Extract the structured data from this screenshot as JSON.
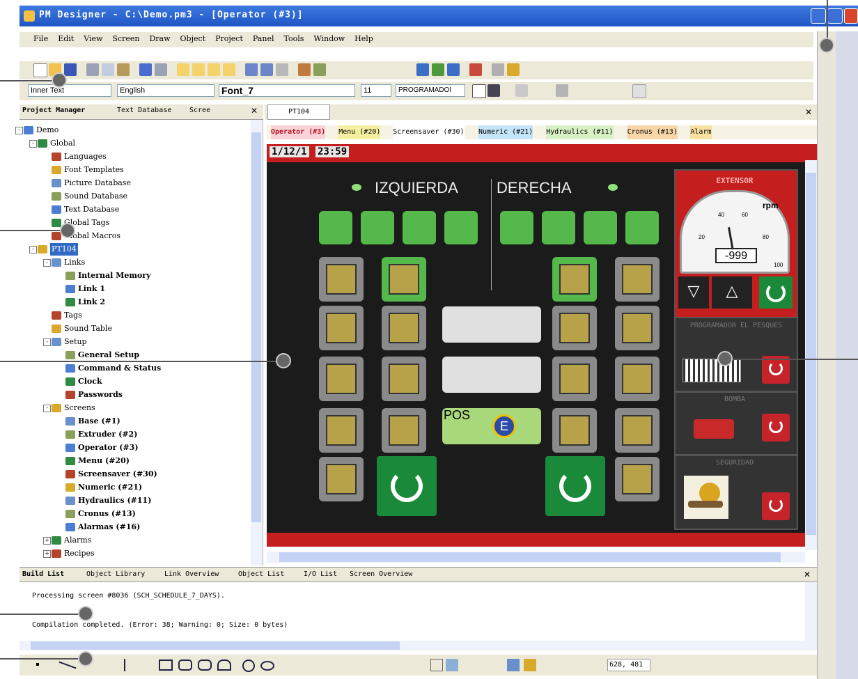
{
  "window": {
    "title": "PM Designer - C:\\Demo.pm3 - [Operator (#3)]",
    "menu": [
      "File",
      "Edit",
      "View",
      "Screen",
      "Draw",
      "Object",
      "Project",
      "Panel",
      "Tools",
      "Window",
      "Help"
    ]
  },
  "format_bar": {
    "text_type": "Inner Text",
    "language": "English",
    "font": "Font_7",
    "size": "11",
    "text_value": "PROGRAMADOI"
  },
  "left_panel": {
    "tabs": [
      "Project Manager",
      "Text Database",
      "Scree"
    ],
    "tree": [
      {
        "label": "Demo",
        "indent": 0,
        "exp": "-"
      },
      {
        "label": "Global",
        "indent": 1,
        "exp": "-"
      },
      {
        "label": "Languages",
        "indent": 2
      },
      {
        "label": "Font Templates",
        "indent": 2
      },
      {
        "label": "Picture Database",
        "indent": 2
      },
      {
        "label": "Sound Database",
        "indent": 2
      },
      {
        "label": "Text Database",
        "indent": 2
      },
      {
        "label": "Global Tags",
        "indent": 2
      },
      {
        "label": "Global Macros",
        "indent": 2
      },
      {
        "label": "PT104",
        "indent": 1,
        "exp": "-",
        "selected": true
      },
      {
        "label": "Links",
        "indent": 2,
        "exp": "-"
      },
      {
        "label": "Internal Memory",
        "indent": 3
      },
      {
        "label": "Link 1",
        "indent": 3
      },
      {
        "label": "Link 2",
        "indent": 3
      },
      {
        "label": "Tags",
        "indent": 2
      },
      {
        "label": "Sound Table",
        "indent": 2
      },
      {
        "label": "Setup",
        "indent": 2,
        "exp": "-"
      },
      {
        "label": "General Setup",
        "indent": 3
      },
      {
        "label": "Command & Status",
        "indent": 3
      },
      {
        "label": "Clock",
        "indent": 3
      },
      {
        "label": "Passwords",
        "indent": 3
      },
      {
        "label": "Screens",
        "indent": 2,
        "exp": "-"
      },
      {
        "label": "Base (#1)",
        "indent": 3
      },
      {
        "label": "Extruder (#2)",
        "indent": 3
      },
      {
        "label": "Operator (#3)",
        "indent": 3
      },
      {
        "label": "Menu (#20)",
        "indent": 3
      },
      {
        "label": "Screensaver (#30)",
        "indent": 3
      },
      {
        "label": "Numeric (#21)",
        "indent": 3
      },
      {
        "label": "Hydraulics (#11)",
        "indent": 3
      },
      {
        "label": "Cronus (#13)",
        "indent": 3
      },
      {
        "label": "Alarmas (#16)",
        "indent": 3
      },
      {
        "label": "Alarms",
        "indent": 2,
        "exp": "+"
      },
      {
        "label": "Recipes",
        "indent": 2,
        "exp": "+"
      }
    ]
  },
  "editor": {
    "doc_tab": "PT104",
    "screen_tabs": [
      "Operator (#3)",
      "Menu (#20)",
      "Screensaver (#30)",
      "Numeric (#21)",
      "Hydraulics (#11)",
      "Cronus (#13)",
      "Alarm"
    ],
    "hmi": {
      "date": "1/12/1",
      "time": "23:59",
      "left_heading": "IZQUIERDA",
      "right_heading": "DERECHA",
      "pos_label": "POS",
      "pos_badge": "E",
      "extensor_title": "EXTENSOR",
      "gauge_unit": "rpm",
      "gauge_value": "-999",
      "gauge_ticks": [
        "20",
        "40",
        "60",
        "80",
        "100"
      ],
      "programador_title": "PROGRAMADOR EL PESQUES",
      "bomba_title": "BOMBA",
      "seguridad_title": "SEGURIDAD"
    }
  },
  "build_panel": {
    "tabs": [
      "Build List",
      "Object Library",
      "Link Overview",
      "Object List",
      "I/O List",
      "Screen Overview"
    ],
    "lines": [
      "Processing screen #8036 (SCH_SCHEDULE_7_DAYS).",
      "Compilation completed. (Error: 38; Warning: 0; Size: 0 bytes)"
    ]
  },
  "status": {
    "coords": "628, 481"
  }
}
